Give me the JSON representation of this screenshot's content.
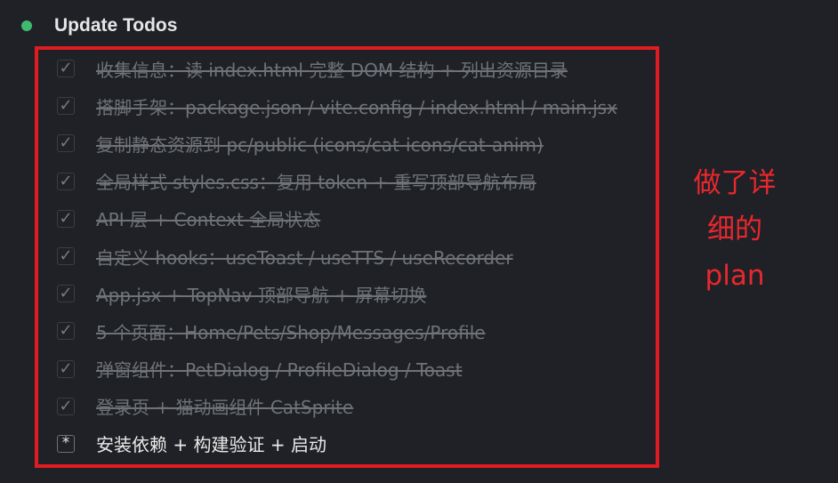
{
  "header": {
    "title": "Update Todos"
  },
  "todos": [
    {
      "status": "done",
      "check": "✓",
      "text": "收集信息：读 index.html 完整 DOM 结构 + 列出资源目录"
    },
    {
      "status": "done",
      "check": "✓",
      "text": "搭脚手架：package.json / vite.config / index.html / main.jsx"
    },
    {
      "status": "done",
      "check": "✓",
      "text": "复制静态资源到 pc/public (icons/cat-icons/cat-anim)"
    },
    {
      "status": "done",
      "check": "✓",
      "text": "全局样式 styles.css：复用 token + 重写顶部导航布局"
    },
    {
      "status": "done",
      "check": "✓",
      "text": "API 层 + Context 全局状态"
    },
    {
      "status": "done",
      "check": "✓",
      "text": "自定义 hooks：useToast / useTTS / useRecorder"
    },
    {
      "status": "done",
      "check": "✓",
      "text": "App.jsx + TopNav 顶部导航 + 屏幕切换"
    },
    {
      "status": "done",
      "check": "✓",
      "text": "5 个页面：Home/Pets/Shop/Messages/Profile"
    },
    {
      "status": "done",
      "check": "✓",
      "text": "弹窗组件：PetDialog / ProfileDialog / Toast"
    },
    {
      "status": "done",
      "check": "✓",
      "text": "登录页 + 猫动画组件 CatSprite"
    },
    {
      "status": "active",
      "check": "*",
      "text": "安装依赖 + 构建验证 + 启动"
    }
  ],
  "annotation": {
    "lines": [
      "做了详",
      "细的",
      "plan"
    ]
  },
  "colors": {
    "background": "#1f2126",
    "status_dot": "#3fb970",
    "annotation_red": "#e01b22",
    "done_text": "#6f7378",
    "active_text": "#e9e9e9"
  }
}
